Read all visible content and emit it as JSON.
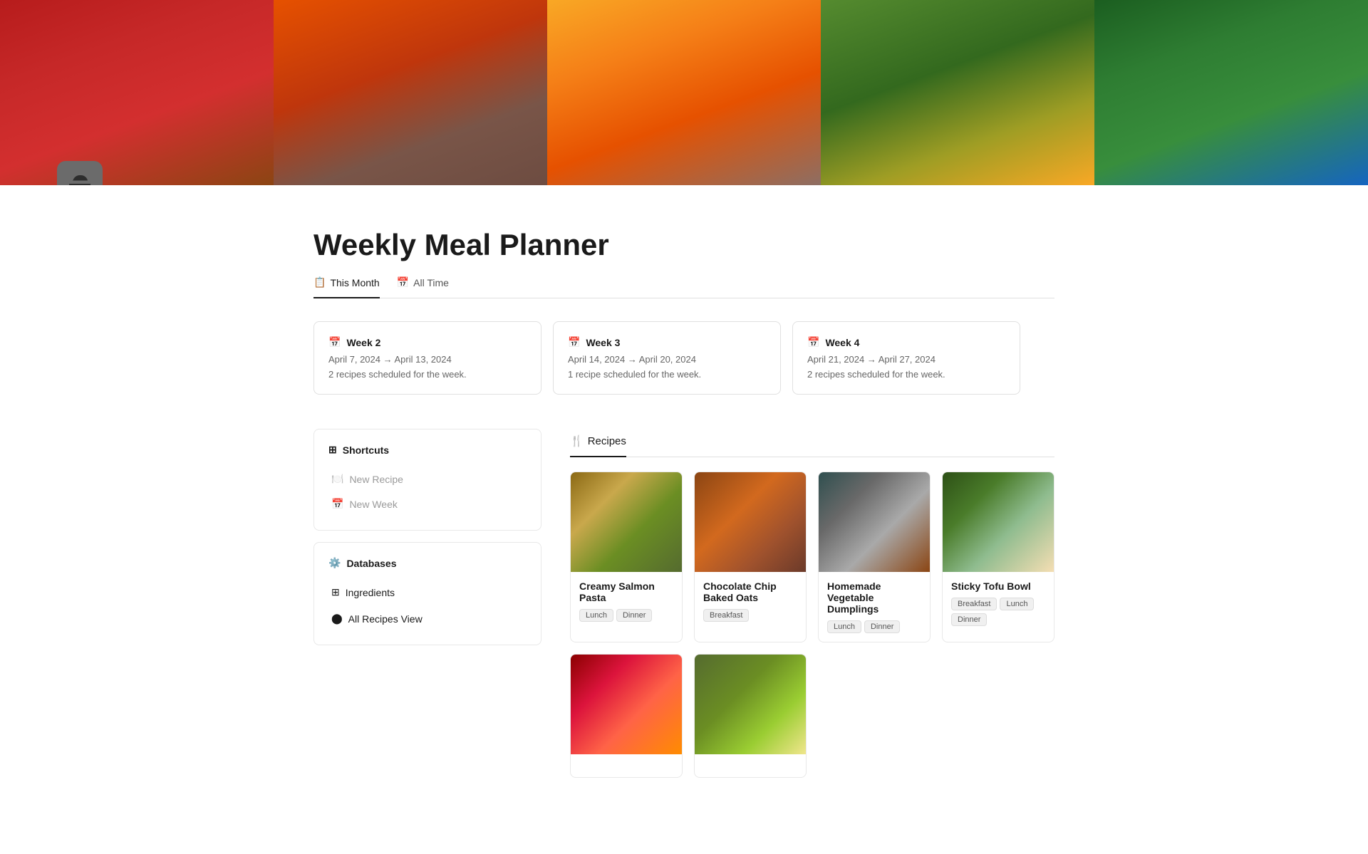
{
  "page": {
    "title": "Weekly Meal Planner",
    "icon": "🍽️"
  },
  "tabs": [
    {
      "id": "this-month",
      "label": "This Month",
      "icon": "📋",
      "active": true
    },
    {
      "id": "all-time",
      "label": "All Time",
      "icon": "📅",
      "active": false
    }
  ],
  "weeks": [
    {
      "id": "week2",
      "title": "Week 2",
      "dates": "April 7, 2024 → April 13, 2024",
      "count": "2 recipes scheduled for the week."
    },
    {
      "id": "week3",
      "title": "Week 3",
      "dates": "April 14, 2024 → April 20, 2024",
      "count": "1 recipe scheduled for the week."
    },
    {
      "id": "week4",
      "title": "Week 4",
      "dates": "April 21, 2024 → April 27, 2024",
      "count": "2 recipes scheduled for the week."
    }
  ],
  "shortcuts": {
    "title": "Shortcuts",
    "items": [
      {
        "id": "new-recipe",
        "label": "New Recipe",
        "icon": "recipe"
      },
      {
        "id": "new-week",
        "label": "New Week",
        "icon": "calendar"
      }
    ]
  },
  "databases": {
    "title": "Databases",
    "items": [
      {
        "id": "ingredients",
        "label": "Ingredients",
        "icon": "grid"
      },
      {
        "id": "all-recipes-view",
        "label": "All Recipes View",
        "icon": "circle"
      }
    ]
  },
  "recipes_tab": {
    "label": "Recipes",
    "icon": "🍴"
  },
  "recipes": [
    {
      "id": "creamy-salmon-pasta",
      "title": "Creamy Salmon Pasta",
      "tags": [
        "Lunch",
        "Dinner"
      ],
      "img_class": "recipe-img-1"
    },
    {
      "id": "chocolate-chip-baked-oats",
      "title": "Chocolate Chip Baked Oats",
      "tags": [
        "Breakfast"
      ],
      "img_class": "recipe-img-2"
    },
    {
      "id": "homemade-vegetable-dumplings",
      "title": "Homemade Vegetable Dumplings",
      "tags": [
        "Lunch",
        "Dinner"
      ],
      "img_class": "recipe-img-3"
    },
    {
      "id": "sticky-tofu-bowl",
      "title": "Sticky Tofu Bowl",
      "tags": [
        "Breakfast",
        "Lunch",
        "Dinner"
      ],
      "img_class": "recipe-img-4"
    },
    {
      "id": "recipe-5",
      "title": "",
      "tags": [],
      "img_class": "recipe-img-5"
    },
    {
      "id": "recipe-6",
      "title": "",
      "tags": [],
      "img_class": "recipe-img-6"
    }
  ]
}
